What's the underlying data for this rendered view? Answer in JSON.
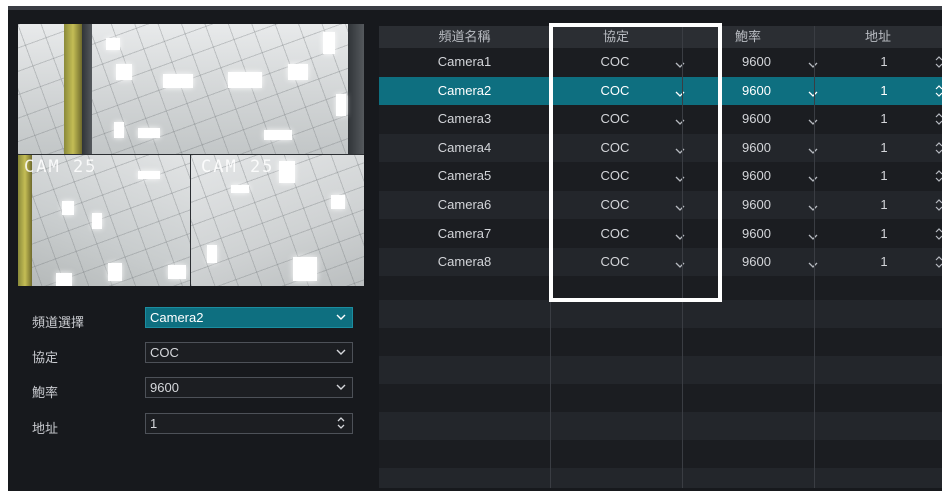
{
  "preview": {
    "cam_labels": [
      "CAM 25",
      "CAM 25"
    ]
  },
  "form": {
    "channel_label": "頻道選擇",
    "channel_value": "Camera2",
    "protocol_label": "協定",
    "protocol_value": "COC",
    "baud_label": "鮑率",
    "baud_value": "9600",
    "address_label": "地址",
    "address_value": "1"
  },
  "table": {
    "headers": [
      "頻道名稱",
      "協定",
      "鮑率",
      "地址"
    ],
    "selected_row": 1,
    "rows": [
      {
        "name": "Camera1",
        "protocol": "COC",
        "baud": "9600",
        "address": "1"
      },
      {
        "name": "Camera2",
        "protocol": "COC",
        "baud": "9600",
        "address": "1"
      },
      {
        "name": "Camera3",
        "protocol": "COC",
        "baud": "9600",
        "address": "1"
      },
      {
        "name": "Camera4",
        "protocol": "COC",
        "baud": "9600",
        "address": "1"
      },
      {
        "name": "Camera5",
        "protocol": "COC",
        "baud": "9600",
        "address": "1"
      },
      {
        "name": "Camera6",
        "protocol": "COC",
        "baud": "9600",
        "address": "1"
      },
      {
        "name": "Camera7",
        "protocol": "COC",
        "baud": "9600",
        "address": "1"
      },
      {
        "name": "Camera8",
        "protocol": "COC",
        "baud": "9600",
        "address": "1"
      }
    ]
  },
  "icons": {
    "dropdown": "chevron-down-icon",
    "spinner": "spinner-up-down-icon"
  },
  "colors": {
    "background": "#17191d",
    "selection": "#0e6f80",
    "header": "#2b2e33",
    "highlight_box": "#ffffff"
  }
}
